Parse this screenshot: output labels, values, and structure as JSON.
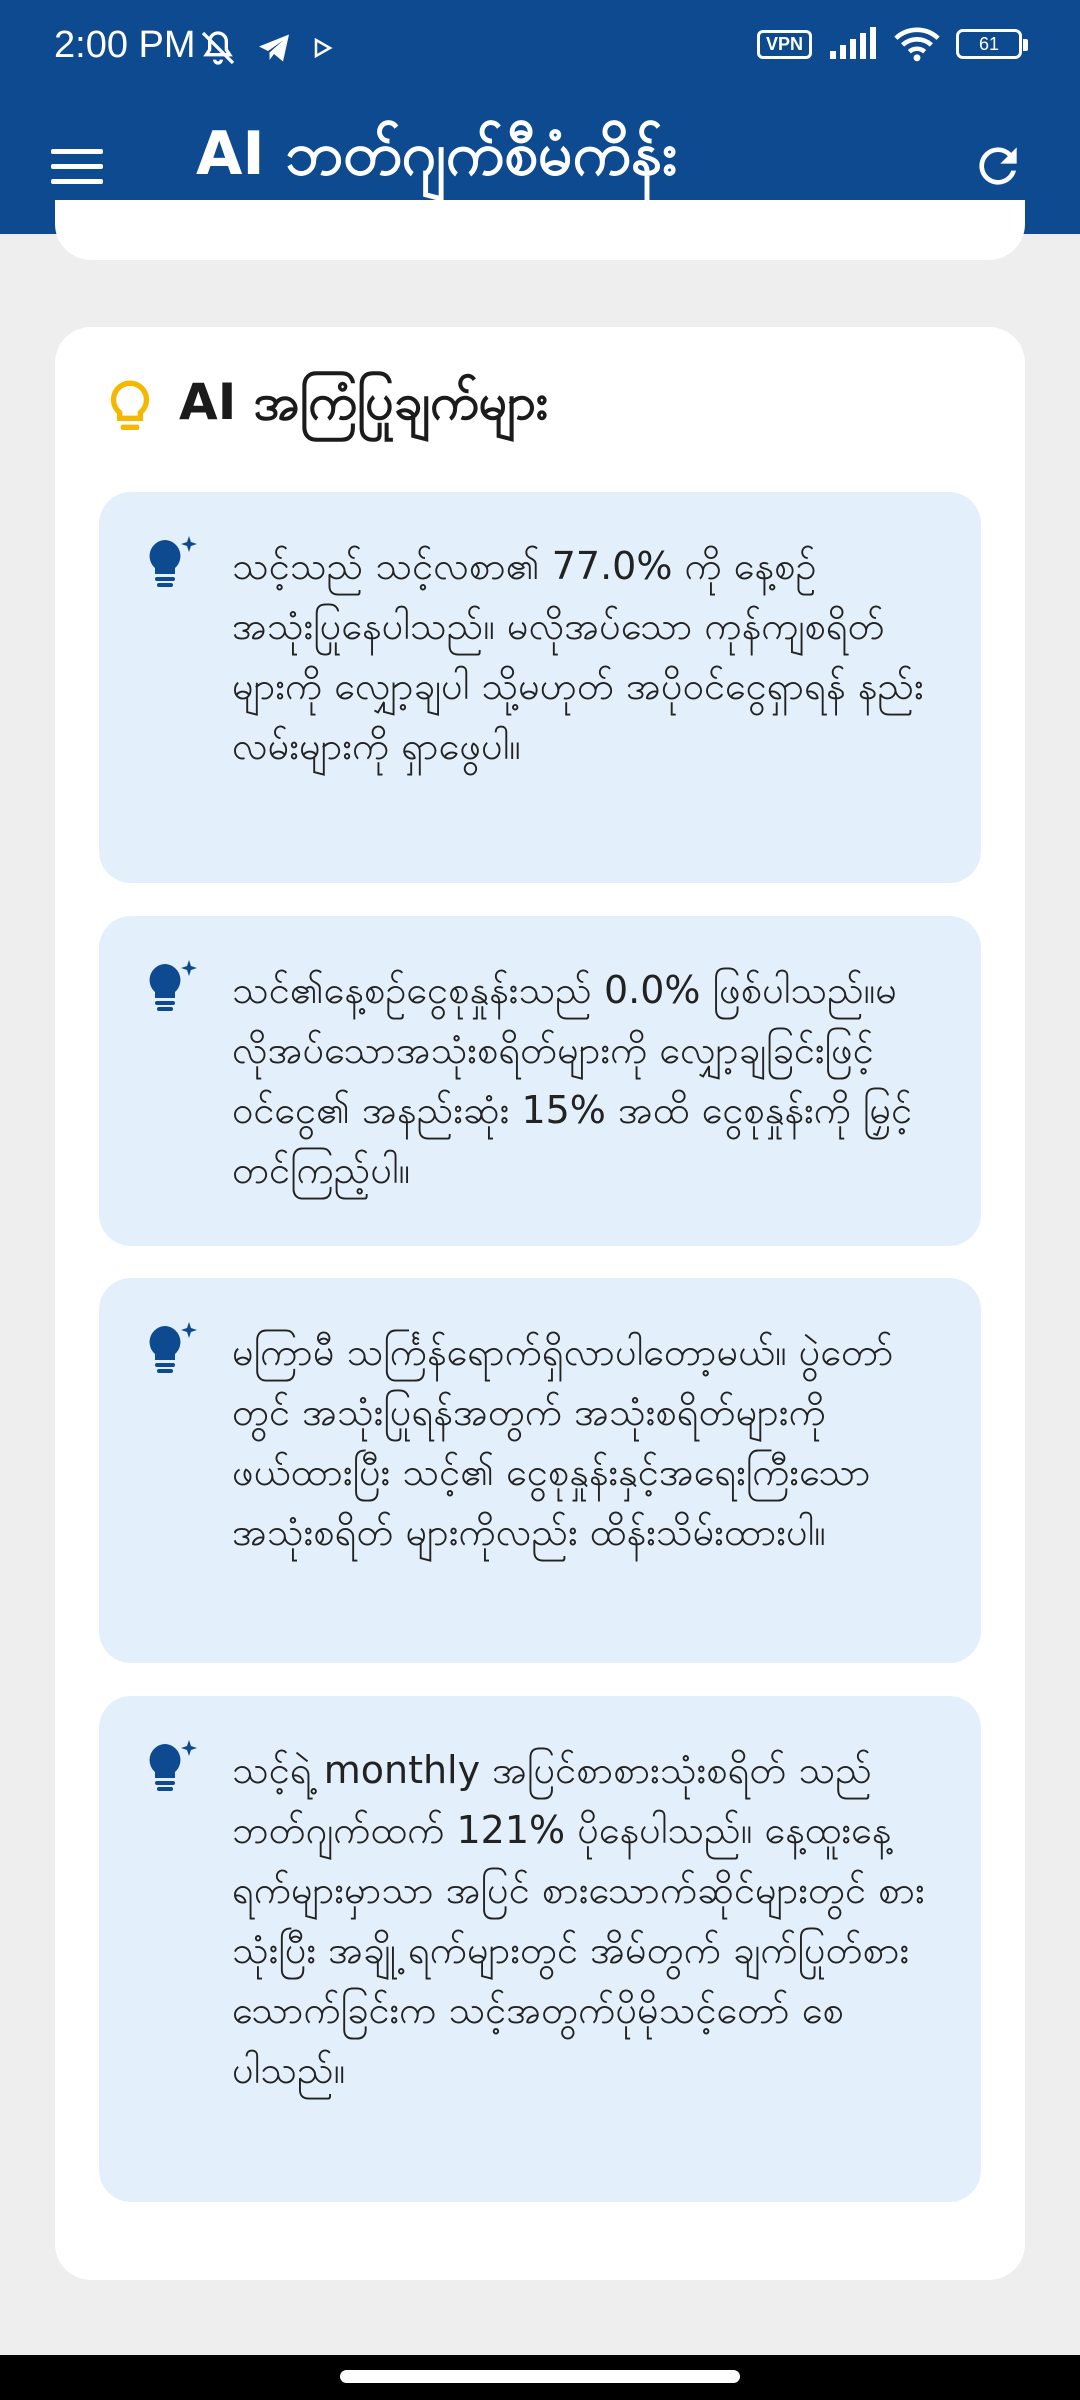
{
  "status_bar": {
    "time": "2:00 PM",
    "vpn_label": "VPN",
    "battery_level": "61"
  },
  "app_bar": {
    "title": "AI ဘတ်ဂျက်စီမံကိန်း"
  },
  "ai_tips": {
    "title": "AI အကြံပြုချက်များ",
    "tips": [
      "သင့်သည် သင့်လစာ၏ 77.0% ကို နေ့စဉ် အသုံးပြုနေပါသည်။ မလိုအပ်သော ကုန်ကျစရိတ်များကို လျှော့ချပါ သို့မဟုတ် အပိုဝင်ငွေရှာရန် နည်းလမ်းများကို ရှာဖွေပါ။",
      "သင်၏နေ့စဉ်ငွေစုနှုန်းသည် 0.0% ဖြစ်ပါသည်။မလိုအပ်သောအသုံးစရိတ်များကို လျှော့ချခြင်းဖြင့် ဝင်ငွေ၏ အနည်းဆုံး 15% အထိ ငွေစုနှုန်းကို မြှင့်တင်ကြည့်ပါ။",
      "မကြာမီ သင်္ကြန်ရောက်ရှိလာပါတော့မယ်။ ပွဲတော်တွင် အသုံးပြုရန်အတွက် အသုံးစရိတ်များကိုဖယ်ထားပြီး သင့်၏ ငွေစုနှုန်းနှင့်အရေးကြီးသောအသုံးစရိတ် များကိုလည်း ထိန်းသိမ်းထားပါ။",
      "သင့်ရဲ့ monthly အပြင်စာစားသုံးစရိတ် သည် ဘတ်ဂျက်ထက် 121% ပိုနေပါသည်။ နေ့ထူးနေ့ရက်များမှာသာ အပြင် စားသောက်ဆိုင်များတွင် စားသုံးပြီး အချို့ ရက်များတွင် အိမ်တွက် ချက်ပြုတ်စား သောက်ခြင်းက သင့်အတွက်ပိုမိုသင့်တော် စေပါသည်။"
    ]
  },
  "colors": {
    "app_bar": "#0d4a8f",
    "tip_background": "#e3f0fb",
    "header_bulb": "#f5b800",
    "tip_icon": "#0d4a8f"
  }
}
